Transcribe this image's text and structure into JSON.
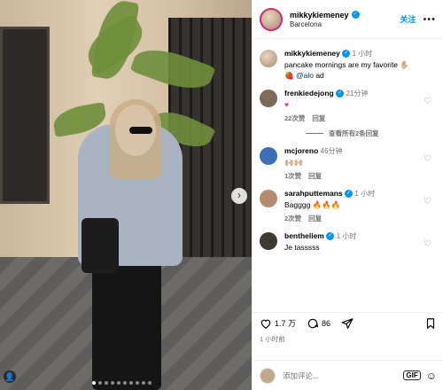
{
  "post": {
    "author": "mikkykiemeney",
    "location": "Barcelona",
    "follow_label": "关注",
    "more_label": "•••",
    "caption": {
      "time": "1 小时",
      "text": "pancake mornings are my favorite ✋🏼",
      "text2_emoji": "🍓",
      "mention": "@alo",
      "suffix": "ad"
    },
    "likes": "1.7 万",
    "comments_count": "86",
    "posted_ago": "1 小时前",
    "photo_nav": {
      "next": "›",
      "tag": "👤"
    }
  },
  "comments": [
    {
      "user": "frenkiedejong",
      "time": "21分钟",
      "text": "♥",
      "likes": "22次赞",
      "reply": "回复",
      "avatar_color": "#7d6a58"
    },
    {
      "user": "mcjoreno",
      "time": "46分钟",
      "text": "🙌🏼🙌🏼",
      "likes": "1次赞",
      "reply": "回复",
      "avatar_color": "#3b6fb6"
    },
    {
      "user": "sarahputtemans",
      "time": "1 小时",
      "text": "Bagggg 🔥🔥🔥",
      "likes": "2次赞",
      "reply": "回复",
      "avatar_color": "#b48c72"
    },
    {
      "user": "bentheliem",
      "time": "1 小时",
      "text": "Je tasssss",
      "likes": "",
      "reply": "",
      "avatar_color": "#3d3a36"
    }
  ],
  "view_replies_label": "查看所有2条回复",
  "comment_placeholder": "添加评论...",
  "gif_label": "GIF",
  "emoji_icon": "☺",
  "colors": {
    "accent": "#0095f6",
    "heart_red": "#ed4956",
    "muted": "#737373"
  }
}
